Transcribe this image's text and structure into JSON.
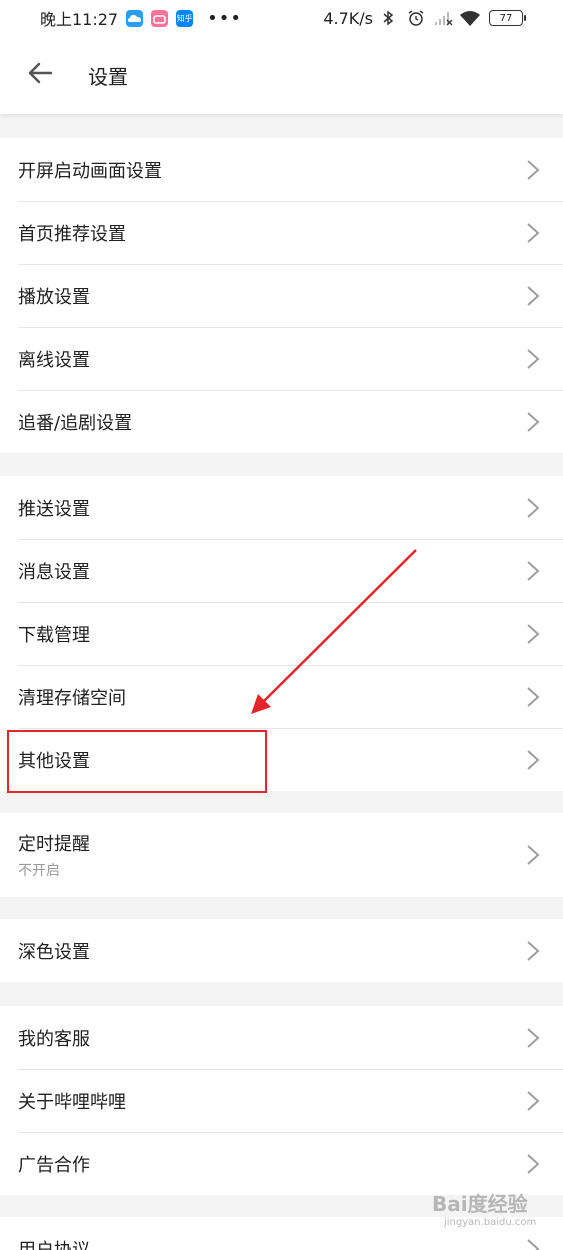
{
  "status_bar": {
    "time": "晚上11:27",
    "app_badge_3": "知乎",
    "more": "•••",
    "speed": "4.7K/s",
    "battery": "77"
  },
  "toolbar": {
    "back_icon": "arrow-left-icon",
    "title": "设置"
  },
  "groups": [
    {
      "items": [
        "开屏启动画面设置",
        "首页推荐设置",
        "播放设置",
        "离线设置",
        "追番/追剧设置"
      ]
    },
    {
      "items": [
        "推送设置",
        "消息设置",
        "下载管理",
        "清理存储空间",
        "其他设置"
      ]
    },
    {
      "items": [
        {
          "label": "定时提醒",
          "sub": "不开启"
        }
      ]
    },
    {
      "items": [
        "深色设置"
      ]
    },
    {
      "items": [
        "我的客服",
        "关于哔哩哔哩",
        "广告合作"
      ]
    },
    {
      "items": [
        "用户协议"
      ]
    }
  ],
  "highlight": {
    "item": "其他设置",
    "color": "#e3262a"
  },
  "watermark": {
    "logo": "Bai度经验",
    "sub": "jingyan.baidu.com"
  },
  "colors": {
    "background": "#f4f4f4",
    "divider": "#e7e7e7",
    "chevron": "#9e9e9e",
    "annotation": "#e3262a"
  }
}
